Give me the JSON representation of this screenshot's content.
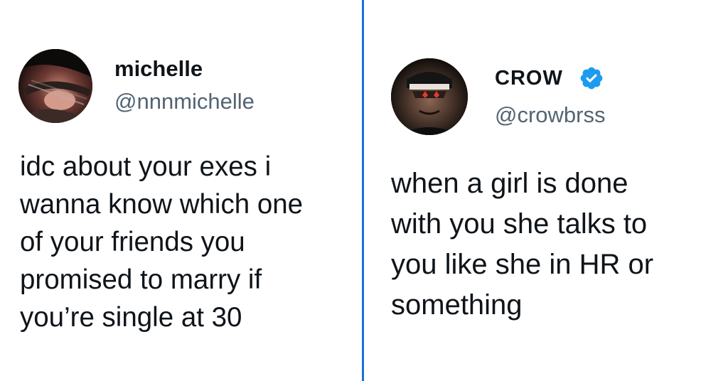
{
  "left_tweet": {
    "display_name": "michelle",
    "handle": "@nnnmichelle",
    "lines": [
      "idc about your exes i",
      "wanna know which one",
      "of your friends you",
      "promised to marry if",
      "you’re single at 30"
    ]
  },
  "right_tweet": {
    "display_name": "CROW",
    "handle": "@crowbrss",
    "verified_icon": "verified-badge-icon",
    "lines": [
      "when a girl is done",
      "with you she talks to",
      "you like she in HR or",
      "something"
    ]
  },
  "colors": {
    "divider": "#1d6fe0",
    "verified": "#1d9bf0",
    "name": "#0f1419",
    "handle": "#536471"
  }
}
